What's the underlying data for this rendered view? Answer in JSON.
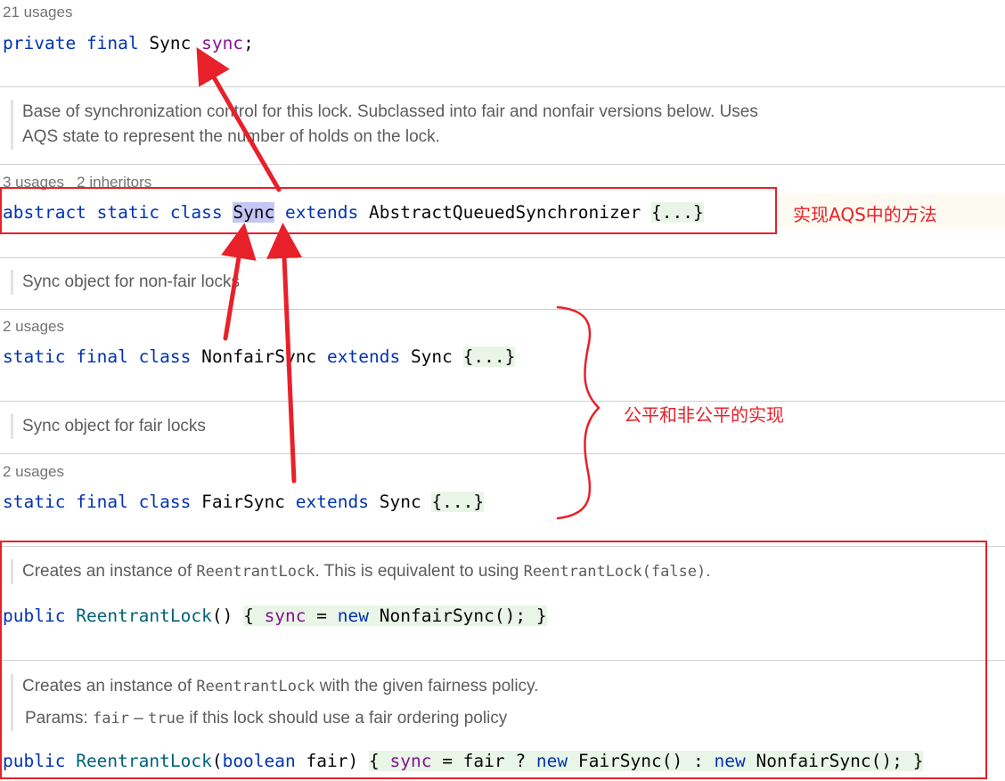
{
  "usages": {
    "u1": "21 usages",
    "u2": "3 usages",
    "u2_inheritors": "2 inheritors",
    "u3": "2 usages",
    "u4": "2 usages"
  },
  "code": {
    "line1": {
      "kw1": "private",
      "kw2": "final",
      "type": "Sync",
      "field": "sync",
      "end": ";"
    },
    "line2": {
      "kw1": "abstract",
      "kw2": "static",
      "kw3": "class",
      "name": "Sync",
      "kw4": "extends",
      "base": "AbstractQueuedSynchronizer",
      "fold": "{...}"
    },
    "line3": {
      "kw1": "static",
      "kw2": "final",
      "kw3": "class",
      "name": "NonfairSync",
      "kw4": "extends",
      "base": "Sync",
      "fold": "{...}"
    },
    "line4": {
      "kw1": "static",
      "kw2": "final",
      "kw3": "class",
      "name": "FairSync",
      "kw4": "extends",
      "base": "Sync",
      "fold": "{...}"
    },
    "line5": {
      "kw1": "public",
      "fn": "ReentrantLock",
      "paren": "()",
      "lb": "{",
      "field": "sync",
      "eq": "=",
      "kw2": "new",
      "ctor": "NonfairSync();",
      "rb": "}"
    },
    "line6": {
      "kw1": "public",
      "fn": "ReentrantLock",
      "open": "(",
      "kw2": "boolean",
      "param": "fair)",
      "lb": "{",
      "field": "sync",
      "rest1": "= fair ?",
      "kw3": "new",
      "ctor1": "FairSync() :",
      "kw4": "new",
      "ctor2": "NonfairSync();",
      "rb": "}"
    }
  },
  "docs": {
    "d1_line1": "Base of synchronization control for this lock. Subclassed into fair and nonfair versions below. Uses",
    "d1_line2": "AQS state to represent the number of holds on the lock.",
    "d2": "Sync object for non-fair locks",
    "d3": "Sync object for fair locks",
    "d4_pre": "Creates an instance of ",
    "d4_code1": "ReentrantLock",
    "d4_mid": ". This is equivalent to using ",
    "d4_code2": "ReentrantLock(false)",
    "d4_end": ".",
    "d5_pre": "Creates an instance of ",
    "d5_code": "ReentrantLock",
    "d5_end": " with the given fairness policy.",
    "d6_label": "Params: ",
    "d6_code1": "fair",
    "d6_dash": " – ",
    "d6_code2": "true",
    "d6_end": " if this lock should use a fair ordering policy"
  },
  "annotations": {
    "aqs_note": "实现AQS中的方法",
    "fair_note": "公平和非公平的实现"
  },
  "colors": {
    "keyword": "#0033b3",
    "field": "#871094",
    "function": "#00627a",
    "annotation": "#e8202a",
    "fold_bg": "#e9f5e6",
    "highlight_bg": "#c4c6f5"
  }
}
